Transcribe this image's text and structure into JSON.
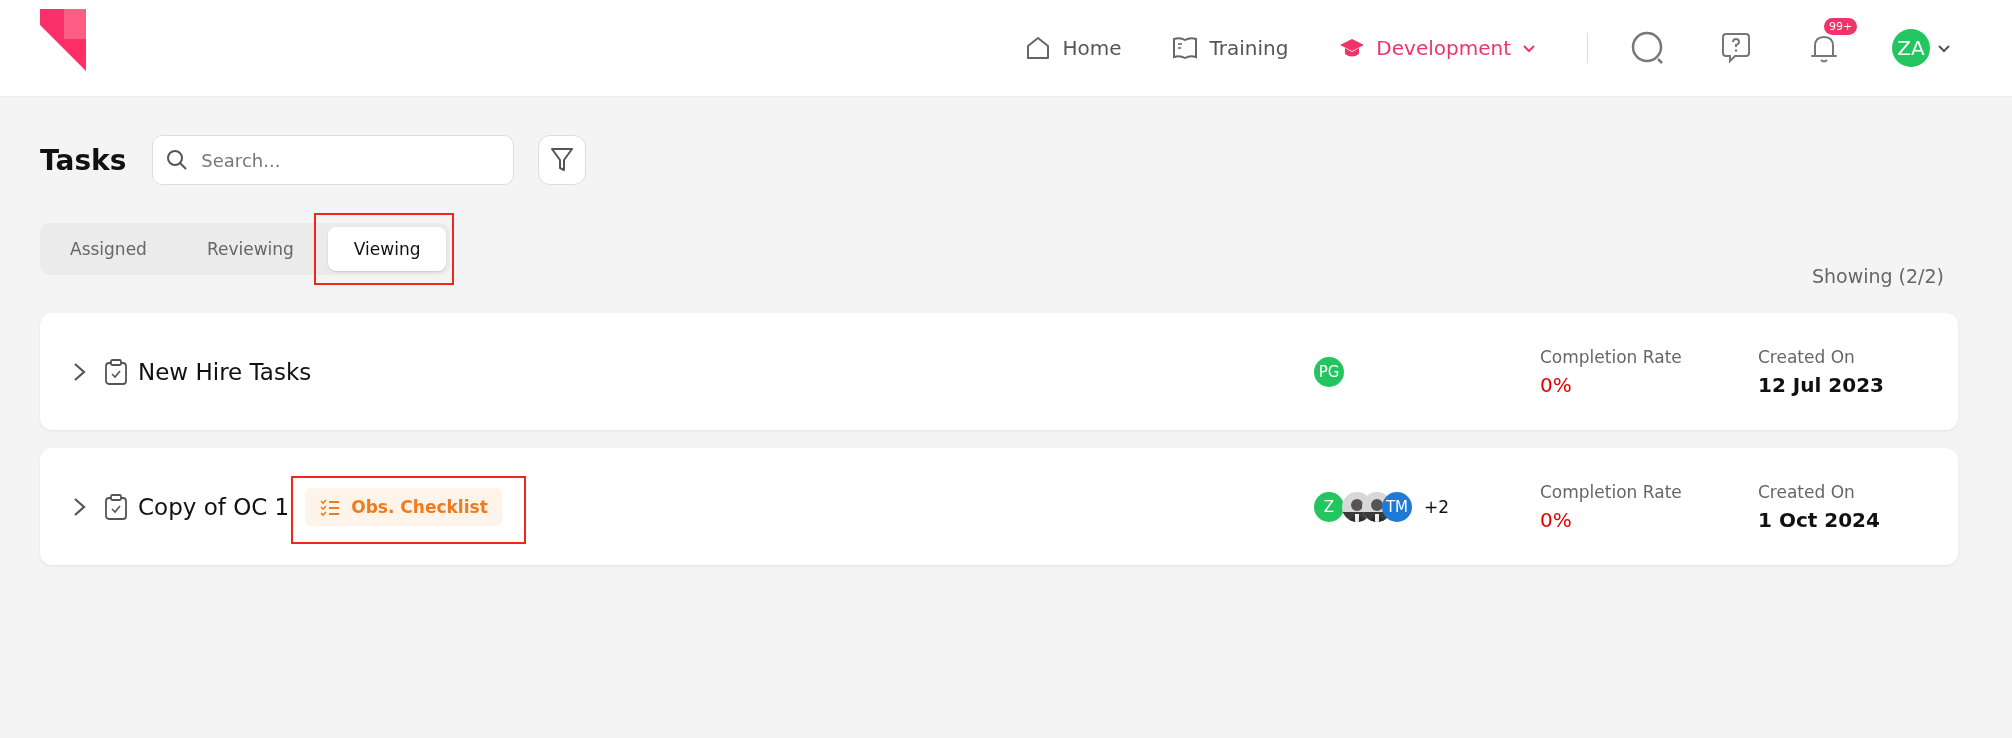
{
  "nav": {
    "items": [
      {
        "label": "Home",
        "selected": false
      },
      {
        "label": "Training",
        "selected": false
      },
      {
        "label": "Development",
        "selected": true,
        "dropdown": true
      }
    ],
    "notification_badge": "99+",
    "user_avatar": {
      "initials": "ZA",
      "color": "#22c55e"
    }
  },
  "page": {
    "title": "Tasks",
    "search": {
      "placeholder": "Search..."
    }
  },
  "tabs": [
    {
      "label": "Assigned",
      "selected": false,
      "highlighted": false
    },
    {
      "label": "Reviewing",
      "selected": false,
      "highlighted": false
    },
    {
      "label": "Viewing",
      "selected": true,
      "highlighted": true
    }
  ],
  "showing": "Showing (2/2)",
  "tasks": [
    {
      "title": "New Hire Tasks",
      "avatars": [
        {
          "kind": "initials",
          "initials": "PG",
          "color": "#22c55e"
        }
      ],
      "completion_label": "Completion Rate",
      "completion": "0%",
      "created_label": "Created On",
      "created": "12 Jul 2023"
    },
    {
      "title": "Copy of OC 1",
      "tag": {
        "label": "Obs. Checklist",
        "highlighted": true
      },
      "avatars": [
        {
          "kind": "initials",
          "initials": "Z",
          "color": "#22c55e"
        },
        {
          "kind": "picture"
        },
        {
          "kind": "picture"
        },
        {
          "kind": "initials",
          "initials": "TM",
          "color": "#1e7ad6"
        }
      ],
      "more": "+2",
      "completion_label": "Completion Rate",
      "completion": "0%",
      "created_label": "Created On",
      "created": "1 Oct 2024"
    }
  ]
}
